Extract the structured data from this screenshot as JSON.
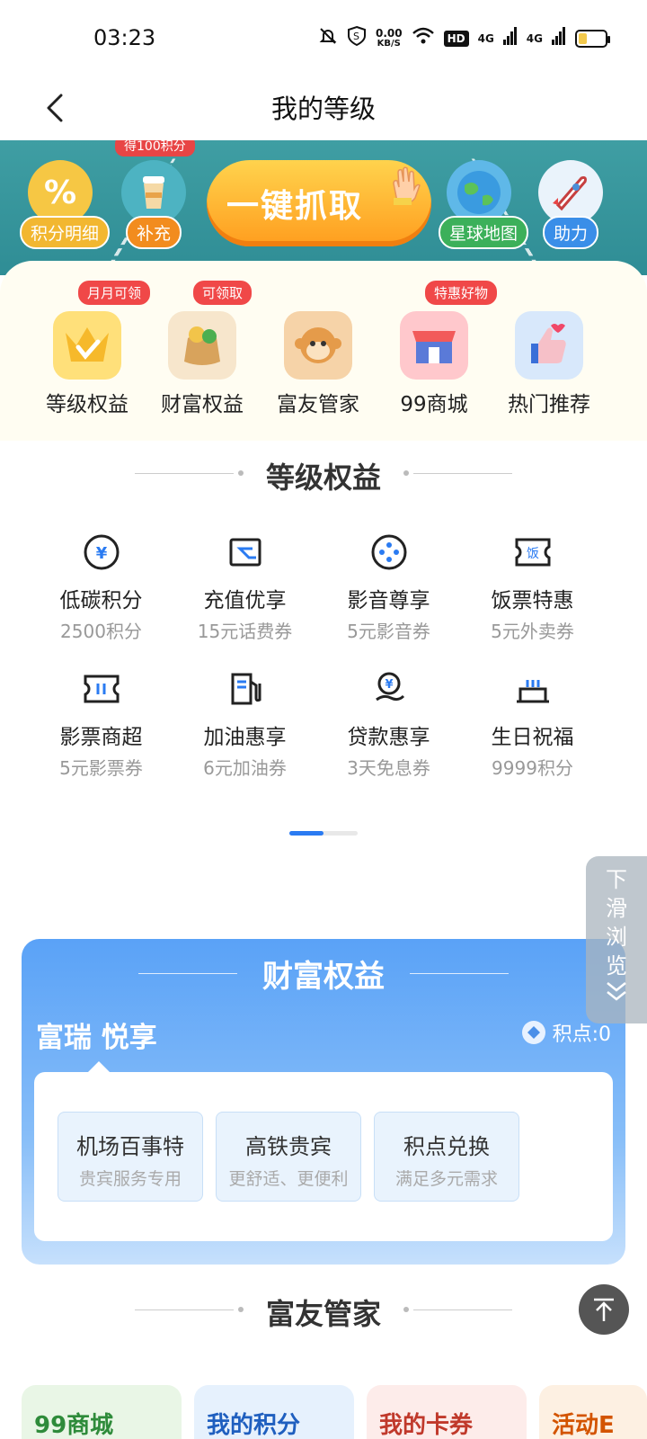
{
  "status_bar": {
    "time": "03:23",
    "speed_value": "0.00",
    "speed_unit": "KB/S",
    "hd": "HD",
    "net1": "4G",
    "net2": "4G"
  },
  "nav": {
    "title": "我的等级",
    "back_icon": "chevron-left-icon"
  },
  "banner": {
    "items": [
      {
        "label": "积分明细",
        "icon": "percent-tag-icon"
      },
      {
        "label": "补充",
        "icon": "cup-icon",
        "tag": "得100积分"
      },
      {
        "label": "星球地图",
        "icon": "globe-icon"
      },
      {
        "label": "助力",
        "icon": "rocket-icon"
      }
    ],
    "grab_button": "一键抓取"
  },
  "quick_links": [
    {
      "label": "等级权益",
      "badge": "月月可领",
      "icon": "crown-icon"
    },
    {
      "label": "财富权益",
      "badge": "可领取",
      "icon": "money-bag-icon"
    },
    {
      "label": "富友管家",
      "badge": "",
      "icon": "monkey-icon"
    },
    {
      "label": "99商城",
      "badge": "特惠好物",
      "icon": "store-icon"
    },
    {
      "label": "热门推荐",
      "badge": "",
      "icon": "thumb-up-icon"
    }
  ],
  "level_benefits": {
    "title": "等级权益",
    "items": [
      {
        "name": "低碳积分",
        "sub": "2500积分",
        "icon": "yen-coin-icon"
      },
      {
        "name": "充值优享",
        "sub": "15元话费券",
        "icon": "wallet-card-icon"
      },
      {
        "name": "影音尊享",
        "sub": "5元影音券",
        "icon": "film-reel-icon"
      },
      {
        "name": "饭票特惠",
        "sub": "5元外卖券",
        "icon": "meal-ticket-icon"
      },
      {
        "name": "影票商超",
        "sub": "5元影票券",
        "icon": "movie-ticket-icon"
      },
      {
        "name": "加油惠享",
        "sub": "6元加油券",
        "icon": "fuel-pump-icon"
      },
      {
        "name": "贷款惠享",
        "sub": "3天免息券",
        "icon": "loan-hand-icon"
      },
      {
        "name": "生日祝福",
        "sub": "9999积分",
        "icon": "birthday-cake-icon"
      }
    ],
    "page_active": 1,
    "page_total": 2
  },
  "wealth": {
    "title": "财富权益",
    "subtitle": "富瑞 悦享",
    "points_label": "积点:0",
    "options": [
      {
        "name": "机场百事特",
        "sub": "贵宾服务专用"
      },
      {
        "name": "高铁贵宾",
        "sub": "更舒适、更便利"
      },
      {
        "name": "积点兑换",
        "sub": "满足多元需求"
      }
    ]
  },
  "slide_hint": {
    "chars": [
      "下",
      "滑",
      "浏",
      "览"
    ]
  },
  "butler": {
    "title": "富友管家",
    "cards": [
      {
        "label": "99商城",
        "color": "#2e8b3a",
        "bg": "#e9f6e6"
      },
      {
        "label": "我的积分",
        "color": "#1f5fbf",
        "bg": "#e6f1fd"
      },
      {
        "label": "我的卡券",
        "color": "#c0392b",
        "bg": "#fdecea"
      },
      {
        "label": "活动E",
        "color": "#d35400",
        "bg": "#fdf0e2"
      }
    ]
  },
  "colors": {
    "accent": "#2a7bf2",
    "badge": "#f04848",
    "banner_bg": "#3f9ea3"
  }
}
